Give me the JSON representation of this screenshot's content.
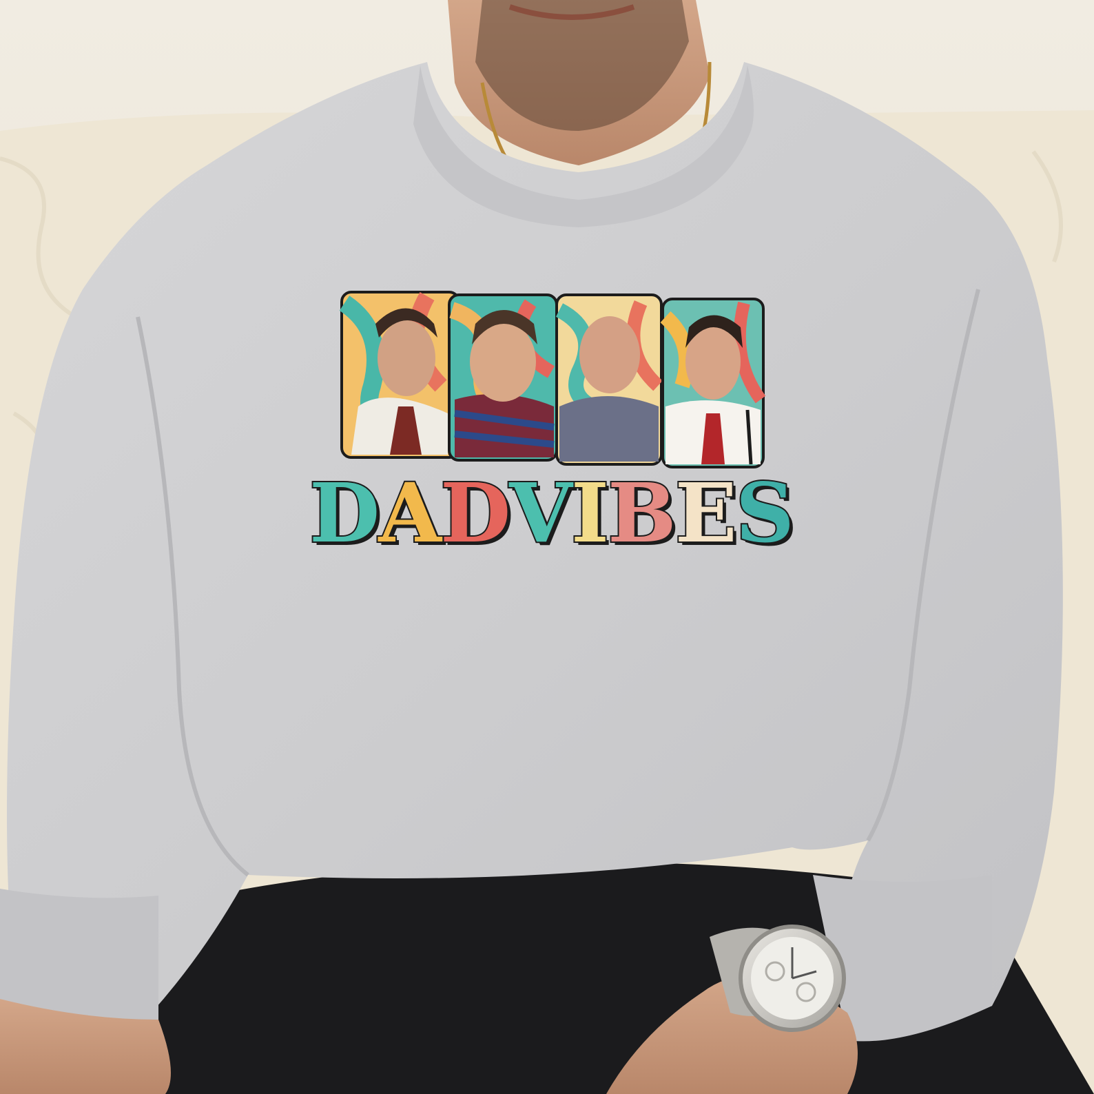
{
  "print": {
    "letters": [
      "D",
      "A",
      "D",
      " ",
      "V",
      "I",
      "B",
      "E",
      "S"
    ],
    "letter_colors": [
      "#4cbfae",
      "#f2b94c",
      "#e5655c",
      "",
      "#4cbfae",
      "#f3dc8a",
      "#e58b84",
      "#f4e3c7",
      "#3fb0a8"
    ]
  },
  "colors": {
    "sweatshirt": "#cfcfd1",
    "background_wall": "#ece5d6",
    "couch": "#efe8d8",
    "jeans": "#1b1b1d",
    "skin": "#c99a7c",
    "watch": "#c9c8c4"
  }
}
